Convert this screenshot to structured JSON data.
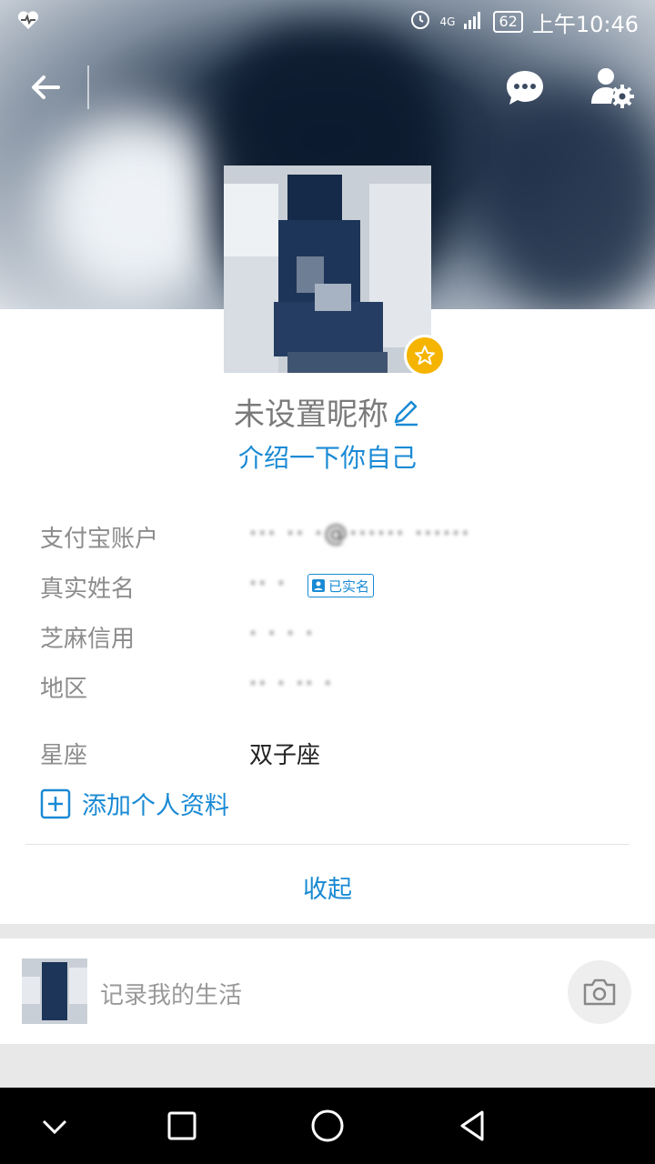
{
  "status": {
    "network": "4G",
    "battery": "62",
    "time": "上午10:46"
  },
  "profile": {
    "nickname": "未设置昵称",
    "intro_link": "介绍一下你自己",
    "verified_badge": "已实名"
  },
  "info_rows": [
    {
      "label": "支付宝账户",
      "value": "··· ·· ·@······ ······"
    },
    {
      "label": "真实姓名",
      "value": "·· ·"
    },
    {
      "label": "芝麻信用",
      "value": "· · · ·"
    },
    {
      "label": "地区",
      "value": "·· · ·· ·"
    },
    {
      "label": "星座",
      "value": "双子座"
    }
  ],
  "add_profile": "添加个人资料",
  "collapse": "收起",
  "post_placeholder": "记录我的生活",
  "colors": {
    "accent": "#1a8ad4",
    "badge": "#f5b400",
    "nav_bg": "#000000"
  },
  "icons": {
    "heartbeat": "heartbeat-icon",
    "alarm": "alarm-icon",
    "signal": "signal-icon",
    "back": "back-arrow-icon",
    "chat": "chat-bubble-icon",
    "settings": "user-settings-icon",
    "edit": "pencil-icon",
    "badge": "star-badge-icon",
    "verified": "id-card-icon",
    "add": "plus-square-icon",
    "camera": "camera-icon",
    "nav_down": "chevron-down-icon",
    "nav_home": "square-icon",
    "nav_circle": "circle-icon",
    "nav_back": "triangle-back-icon"
  }
}
